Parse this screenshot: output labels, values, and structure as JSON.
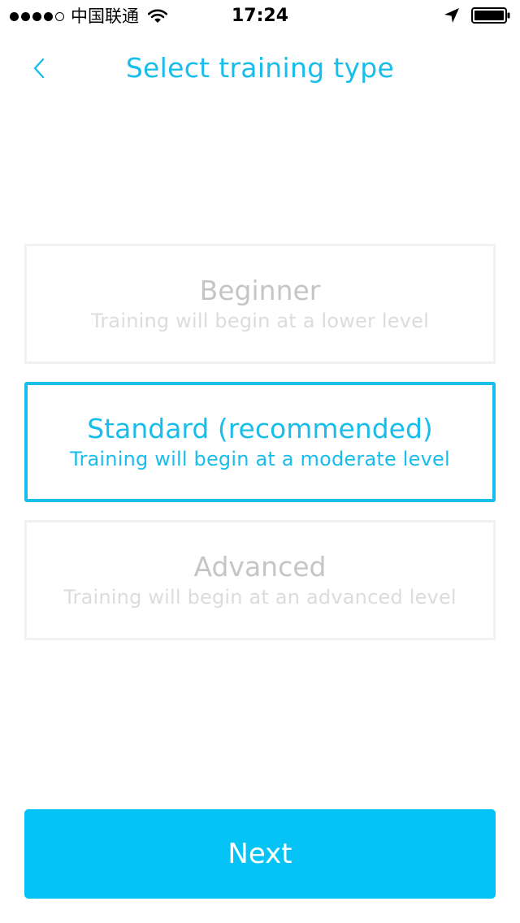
{
  "status_bar": {
    "carrier": "中国联通",
    "time": "17:24",
    "signal_filled": 4,
    "signal_total": 5,
    "icons": [
      "wifi-icon",
      "location-arrow-icon",
      "battery-icon"
    ]
  },
  "nav": {
    "title": "Select training type",
    "back_icon": "chevron-left-icon"
  },
  "options": [
    {
      "title": "Beginner",
      "description": "Training will begin at a lower level",
      "selected": false
    },
    {
      "title": "Standard (recommended)",
      "description": "Training will begin at a moderate level",
      "selected": true
    },
    {
      "title": "Advanced",
      "description": "Training will begin at an advanced level",
      "selected": false
    }
  ],
  "next_button": {
    "label": "Next"
  },
  "colors": {
    "accent": "#19bdeb",
    "button": "#06c3f6",
    "unselected_border": "#f1f1f1",
    "unselected_title": "#c5c5c5",
    "unselected_desc": "#dcdcdc"
  }
}
